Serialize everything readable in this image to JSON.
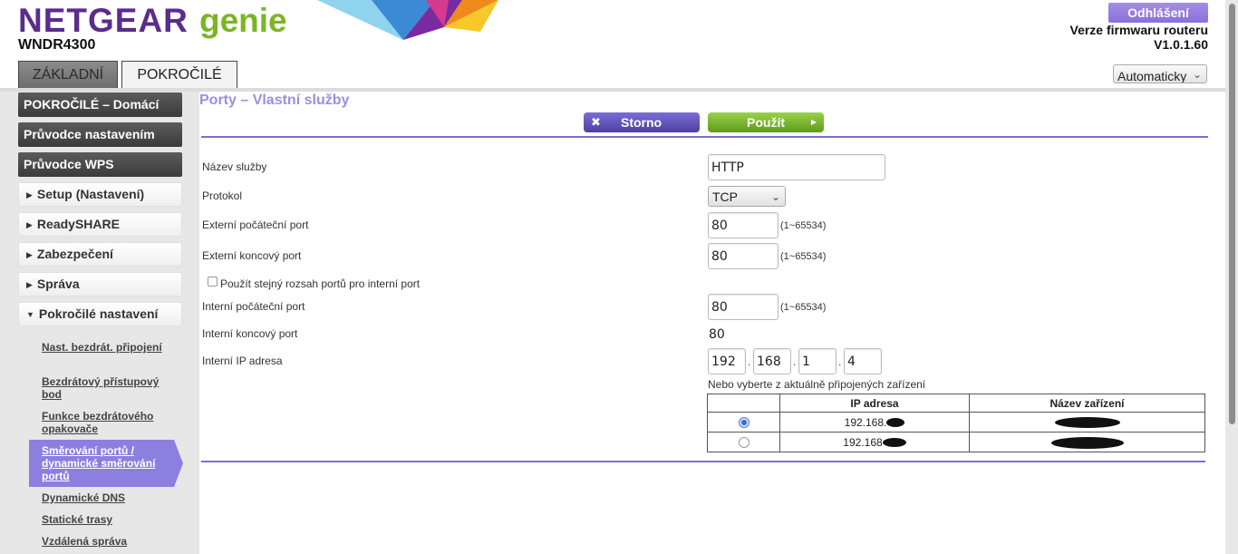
{
  "header": {
    "brand": "NETGEAR",
    "product": "genie",
    "model": "WNDR4300",
    "logout_label": "Odhlášení",
    "firmware_label": "Verze firmwaru routeru",
    "firmware_version": "V1.0.1.60",
    "language_selected": "Automaticky",
    "brand_colors": {
      "netgear": "#5b2c8a",
      "genie": "#7bb526",
      "accent": "#8c7fe0"
    }
  },
  "tabs": [
    {
      "label": "ZÁKLADNÍ",
      "active": false
    },
    {
      "label": "POKROČILÉ",
      "active": true
    }
  ],
  "sidebar": {
    "dark_items": [
      {
        "label": "POKROČILÉ – Domácí"
      },
      {
        "label": "Průvodce nastavením"
      },
      {
        "label": "Průvodce WPS"
      }
    ],
    "sections": [
      {
        "label": "Setup (Nastavení)",
        "expanded": false
      },
      {
        "label": "ReadySHARE",
        "expanded": false
      },
      {
        "label": "Zabezpečení",
        "expanded": false
      },
      {
        "label": "Správa",
        "expanded": false
      },
      {
        "label": "Pokročilé nastavení",
        "expanded": true
      }
    ],
    "sub_items": [
      {
        "label": "Nast. bezdrát. připojení"
      },
      {
        "label": "Bezdrátový přístupový bod"
      },
      {
        "label": "Funkce bezdrátového opakovače"
      },
      {
        "label": "Směrování portů / dynamické směrování portů",
        "active": true
      },
      {
        "label": "Dynamické DNS"
      },
      {
        "label": "Statické trasy"
      },
      {
        "label": "Vzdálená správa"
      }
    ]
  },
  "main": {
    "title": "Porty – Vlastní služby",
    "cancel_label": "Storno",
    "apply_label": "Použít",
    "form": {
      "service_name_label": "Název služby",
      "service_name_value": "HTTP",
      "protocol_label": "Protokol",
      "protocol_value": "TCP",
      "ext_start_label": "Externí počáteční port",
      "ext_start_value": "80",
      "ext_end_label": "Externí koncový port",
      "ext_end_value": "80",
      "range_hint": "(1~65534)",
      "same_range_label": "Použít stejný rozsah portů pro interní port",
      "same_range_checked": false,
      "int_start_label": "Interní počáteční port",
      "int_start_value": "80",
      "int_end_label": "Interní koncový port",
      "int_end_value": "80",
      "ip_label": "Interní IP adresa",
      "ip_octets": [
        "192",
        "168",
        "1",
        "4"
      ],
      "select_note": "Nebo vyberte z aktuálně připojených zařízení"
    },
    "devices_table": {
      "headers": [
        "",
        "IP adresa",
        "Název zařízení"
      ],
      "rows": [
        {
          "ip_visible": "192.168.",
          "selected": true
        },
        {
          "ip_visible": "192.168",
          "selected": false
        }
      ]
    }
  }
}
